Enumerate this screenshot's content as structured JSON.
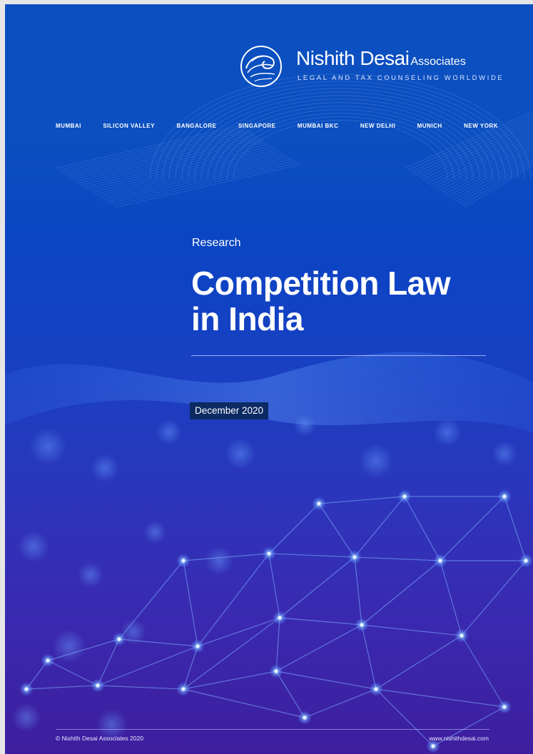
{
  "brand": {
    "name": "Nishith Desai",
    "name_suffix": "Associates",
    "tagline": "LEGAL AND TAX COUNSELING WORLDWIDE"
  },
  "cities": [
    "MUMBAI",
    "SILICON VALLEY",
    "BANGALORE",
    "SINGAPORE",
    "MUMBAI BKC",
    "NEW DELHI",
    "MUNICH",
    "NEW YORK"
  ],
  "cover": {
    "kicker": "Research",
    "title_lines": [
      "Competition Law",
      "in India"
    ],
    "date": "December 2020"
  },
  "footer": {
    "copyright": "© Nishith Desai Associates 2020",
    "website": "www.nishithdesai.com"
  },
  "colors": {
    "background_top": "#0b4fc0",
    "background_bottom": "#3d1e9e",
    "date_badge": "#0c2a63",
    "text": "#ffffff"
  }
}
